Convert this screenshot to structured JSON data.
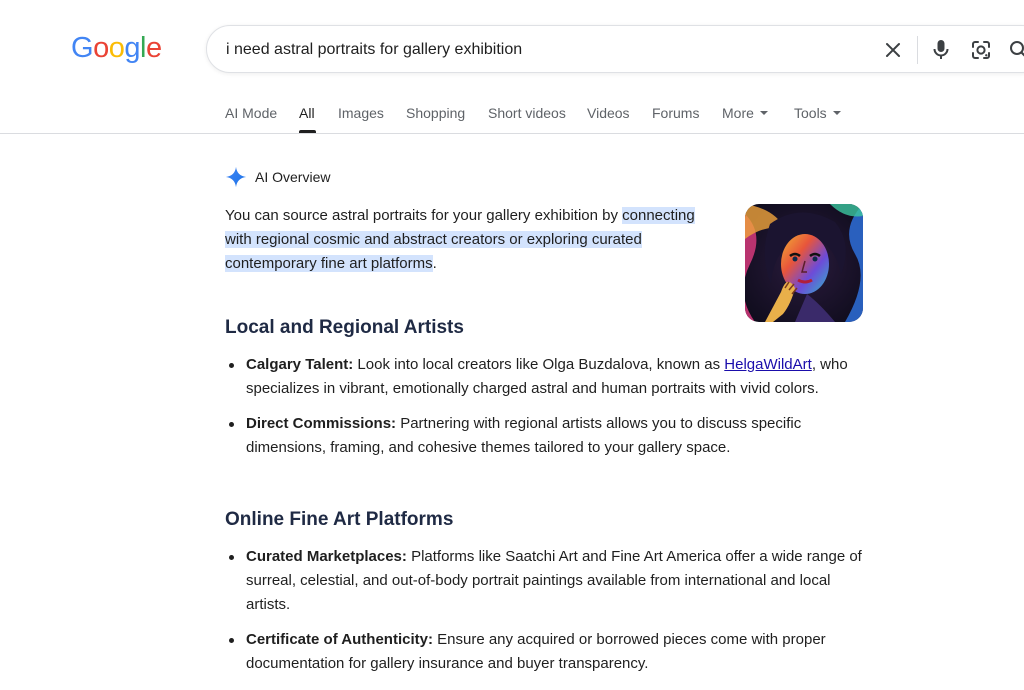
{
  "logo": {
    "letters": [
      "G",
      "o",
      "o",
      "g",
      "l",
      "e"
    ],
    "colors": [
      "#4285F4",
      "#EA4335",
      "#FBBC05",
      "#4285F4",
      "#34A853",
      "#EA4335"
    ]
  },
  "search": {
    "query": "i need astral portraits for gallery exhibition"
  },
  "search_icons": [
    "close-icon",
    "microphone-icon",
    "lens-icon",
    "search-icon"
  ],
  "tabs": [
    {
      "label": "AI Mode"
    },
    {
      "label": "All",
      "active": true
    },
    {
      "label": "Images"
    },
    {
      "label": "Shopping"
    },
    {
      "label": "Short videos"
    },
    {
      "label": "Videos"
    },
    {
      "label": "Forums"
    },
    {
      "label": "More"
    },
    {
      "label": "Tools"
    }
  ],
  "ai_overview": {
    "label": "AI Overview",
    "intro_plain": "You can source astral portraits for your gallery exhibition by ",
    "intro_highlight": "connecting with regional cosmic and abstract creators or exploring curated contemporary fine art platforms",
    "intro_end": ".",
    "sections": [
      {
        "heading": "Local and Regional Artists",
        "items": [
          {
            "title": "Calgary Talent:",
            "text_before": " Look into local creators like Olga Buzdalova, known as ",
            "link": "HelgaWildArt",
            "text_after": ", who specializes in vibrant, emotionally charged astral and human portraits with vivid colors."
          },
          {
            "title": "Direct Commissions:",
            "text": " Partnering with regional artists allows you to discuss specific dimensions, framing, and cohesive themes tailored to your gallery space."
          }
        ]
      },
      {
        "heading": "Online Fine Art Platforms",
        "items": [
          {
            "title": "Curated Marketplaces:",
            "text": " Platforms like Saatchi Art and Fine Art America offer a wide range of surreal, celestial, and out-of-body portrait paintings available from international and local artists."
          },
          {
            "title": "Certificate of Authenticity:",
            "text": " Ensure any acquired or borrowed pieces come with proper documentation for gallery insurance and buyer transparency."
          }
        ]
      }
    ]
  },
  "colors": {
    "accent_blue": "#1a73e8",
    "highlight": "#d3e3fd",
    "link": "#1a0dab"
  }
}
